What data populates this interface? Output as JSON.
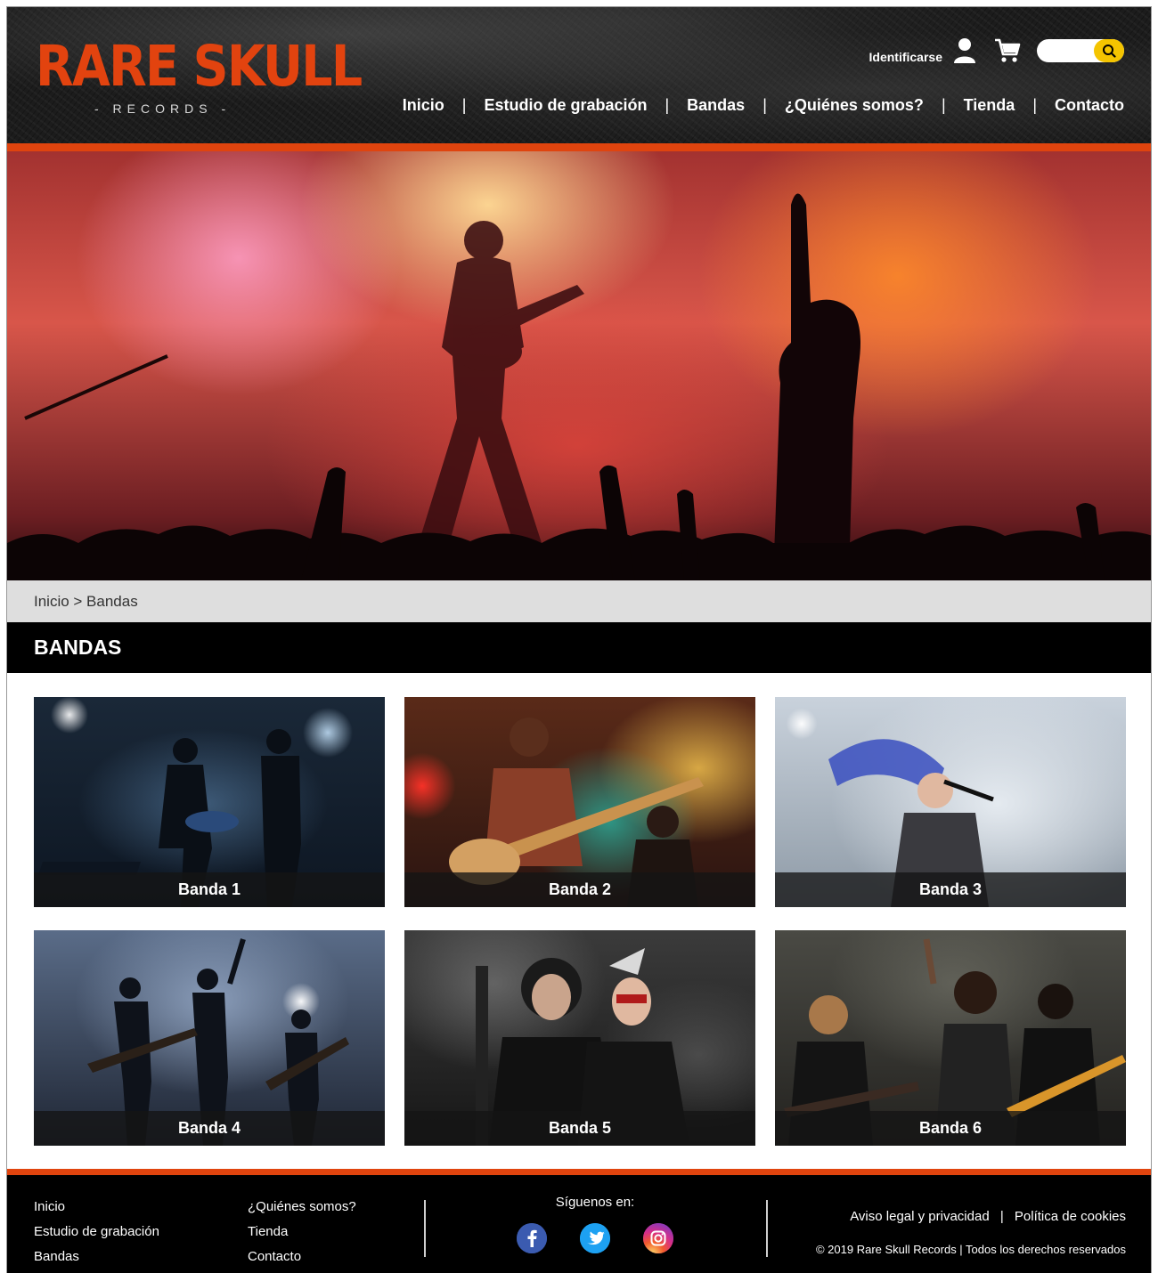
{
  "brand": {
    "logo_text": "RARE SKULL",
    "logo_sub": "- RECORDS -",
    "accent_color": "#e0440e"
  },
  "header": {
    "login_label": "Identificarse",
    "icons": [
      "user-icon",
      "cart-icon",
      "search-icon"
    ],
    "search": {
      "placeholder": ""
    }
  },
  "nav": {
    "items": [
      {
        "label": "Inicio"
      },
      {
        "label": "Estudio de grabación"
      },
      {
        "label": "Bandas"
      },
      {
        "label": "¿Quiénes somos?"
      },
      {
        "label": "Tienda"
      },
      {
        "label": "Contacto"
      }
    ],
    "separator": "|"
  },
  "breadcrumb": {
    "text": "Inicio > Bandas"
  },
  "page": {
    "title": "BANDAS"
  },
  "bands": [
    {
      "label": "Banda 1"
    },
    {
      "label": "Banda 2"
    },
    {
      "label": "Banda 3"
    },
    {
      "label": "Banda 4"
    },
    {
      "label": "Banda 5"
    },
    {
      "label": "Banda 6"
    }
  ],
  "footer": {
    "col1": [
      "Inicio",
      "Estudio de grabación",
      "Bandas"
    ],
    "col2": [
      "¿Quiénes somos?",
      "Tienda",
      "Contacto"
    ],
    "follow_label": "Síguenos en:",
    "socials": [
      {
        "icon": "facebook-icon",
        "glyph": "f",
        "color": "#3b5bb0"
      },
      {
        "icon": "twitter-icon",
        "glyph": "t",
        "color": "#1da1f2"
      },
      {
        "icon": "instagram-icon",
        "glyph": "◎",
        "color": "#d62e8a"
      }
    ],
    "legal": {
      "aviso": "Aviso legal y privacidad",
      "sep": "|",
      "cookies": "Política de cookies"
    },
    "copyright": "© 2019 Rare Skull Records | Todos los derechos reservados"
  }
}
